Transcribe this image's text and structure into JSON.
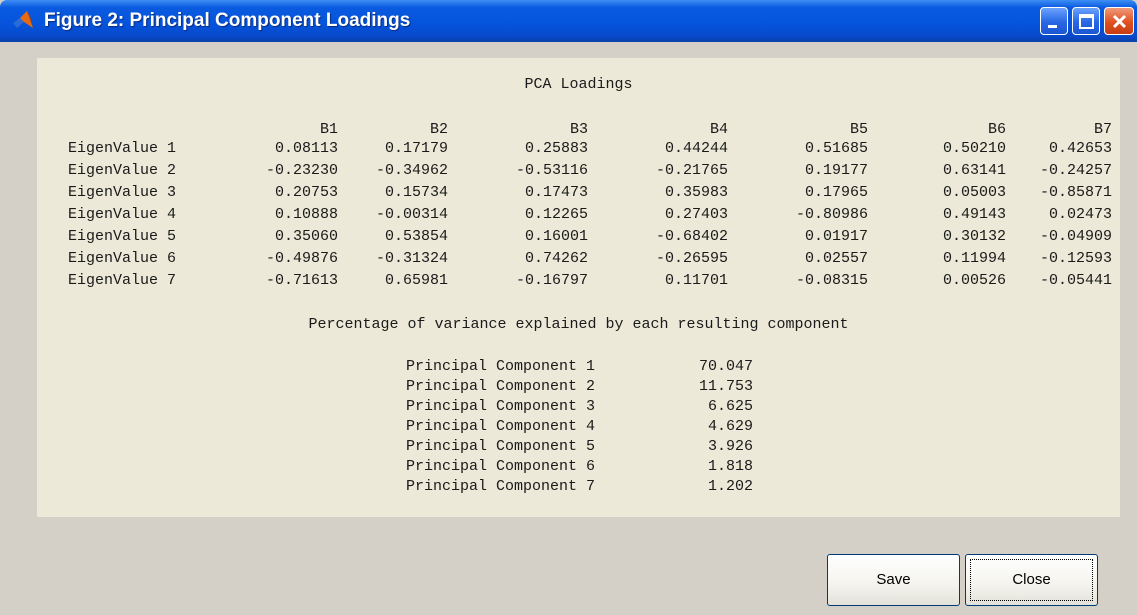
{
  "window": {
    "title": "Figure 2: Principal Component Loadings",
    "app_icon": "matlab-icon",
    "controls": [
      "minimize-icon",
      "maximize-icon",
      "close-icon"
    ]
  },
  "loadings": {
    "title": "PCA Loadings",
    "columns": [
      "B1",
      "B2",
      "B3",
      "B4",
      "B5",
      "B6",
      "B7"
    ],
    "rows": [
      {
        "label": "EigenValue 1",
        "values": [
          "0.08113",
          "0.17179",
          "0.25883",
          "0.44244",
          "0.51685",
          "0.50210",
          "0.42653"
        ]
      },
      {
        "label": "EigenValue 2",
        "values": [
          "-0.23230",
          "-0.34962",
          "-0.53116",
          "-0.21765",
          "0.19177",
          "0.63141",
          "-0.24257"
        ]
      },
      {
        "label": "EigenValue 3",
        "values": [
          "0.20753",
          "0.15734",
          "0.17473",
          "0.35983",
          "0.17965",
          "0.05003",
          "-0.85871"
        ]
      },
      {
        "label": "EigenValue 4",
        "values": [
          "0.10888",
          "-0.00314",
          "0.12265",
          "0.27403",
          "-0.80986",
          "0.49143",
          "0.02473"
        ]
      },
      {
        "label": "EigenValue 5",
        "values": [
          "0.35060",
          "0.53854",
          "0.16001",
          "-0.68402",
          "0.01917",
          "0.30132",
          "-0.04909"
        ]
      },
      {
        "label": "EigenValue 6",
        "values": [
          "-0.49876",
          "-0.31324",
          "0.74262",
          "-0.26595",
          "0.02557",
          "0.11994",
          "-0.12593"
        ]
      },
      {
        "label": "EigenValue 7",
        "values": [
          "-0.71613",
          "0.65981",
          "-0.16797",
          "0.11701",
          "-0.08315",
          "0.00526",
          "-0.05441"
        ]
      }
    ]
  },
  "variance": {
    "title": "Percentage of variance explained by each resulting component",
    "components": [
      {
        "label": "Principal Component 1",
        "value": "70.047"
      },
      {
        "label": "Principal Component 2",
        "value": "11.753"
      },
      {
        "label": "Principal Component 3",
        "value": "6.625"
      },
      {
        "label": "Principal Component 4",
        "value": "4.629"
      },
      {
        "label": "Principal Component 5",
        "value": "3.926"
      },
      {
        "label": "Principal Component 6",
        "value": "1.818"
      },
      {
        "label": "Principal Component 7",
        "value": "1.202"
      }
    ]
  },
  "buttons": {
    "save_label": "Save",
    "close_label": "Close"
  },
  "colors": {
    "title_bar": "#0553dc",
    "panel_bg": "#ece9d8",
    "window_bg": "#d4d0c8",
    "close_btn": "#e0501f"
  }
}
